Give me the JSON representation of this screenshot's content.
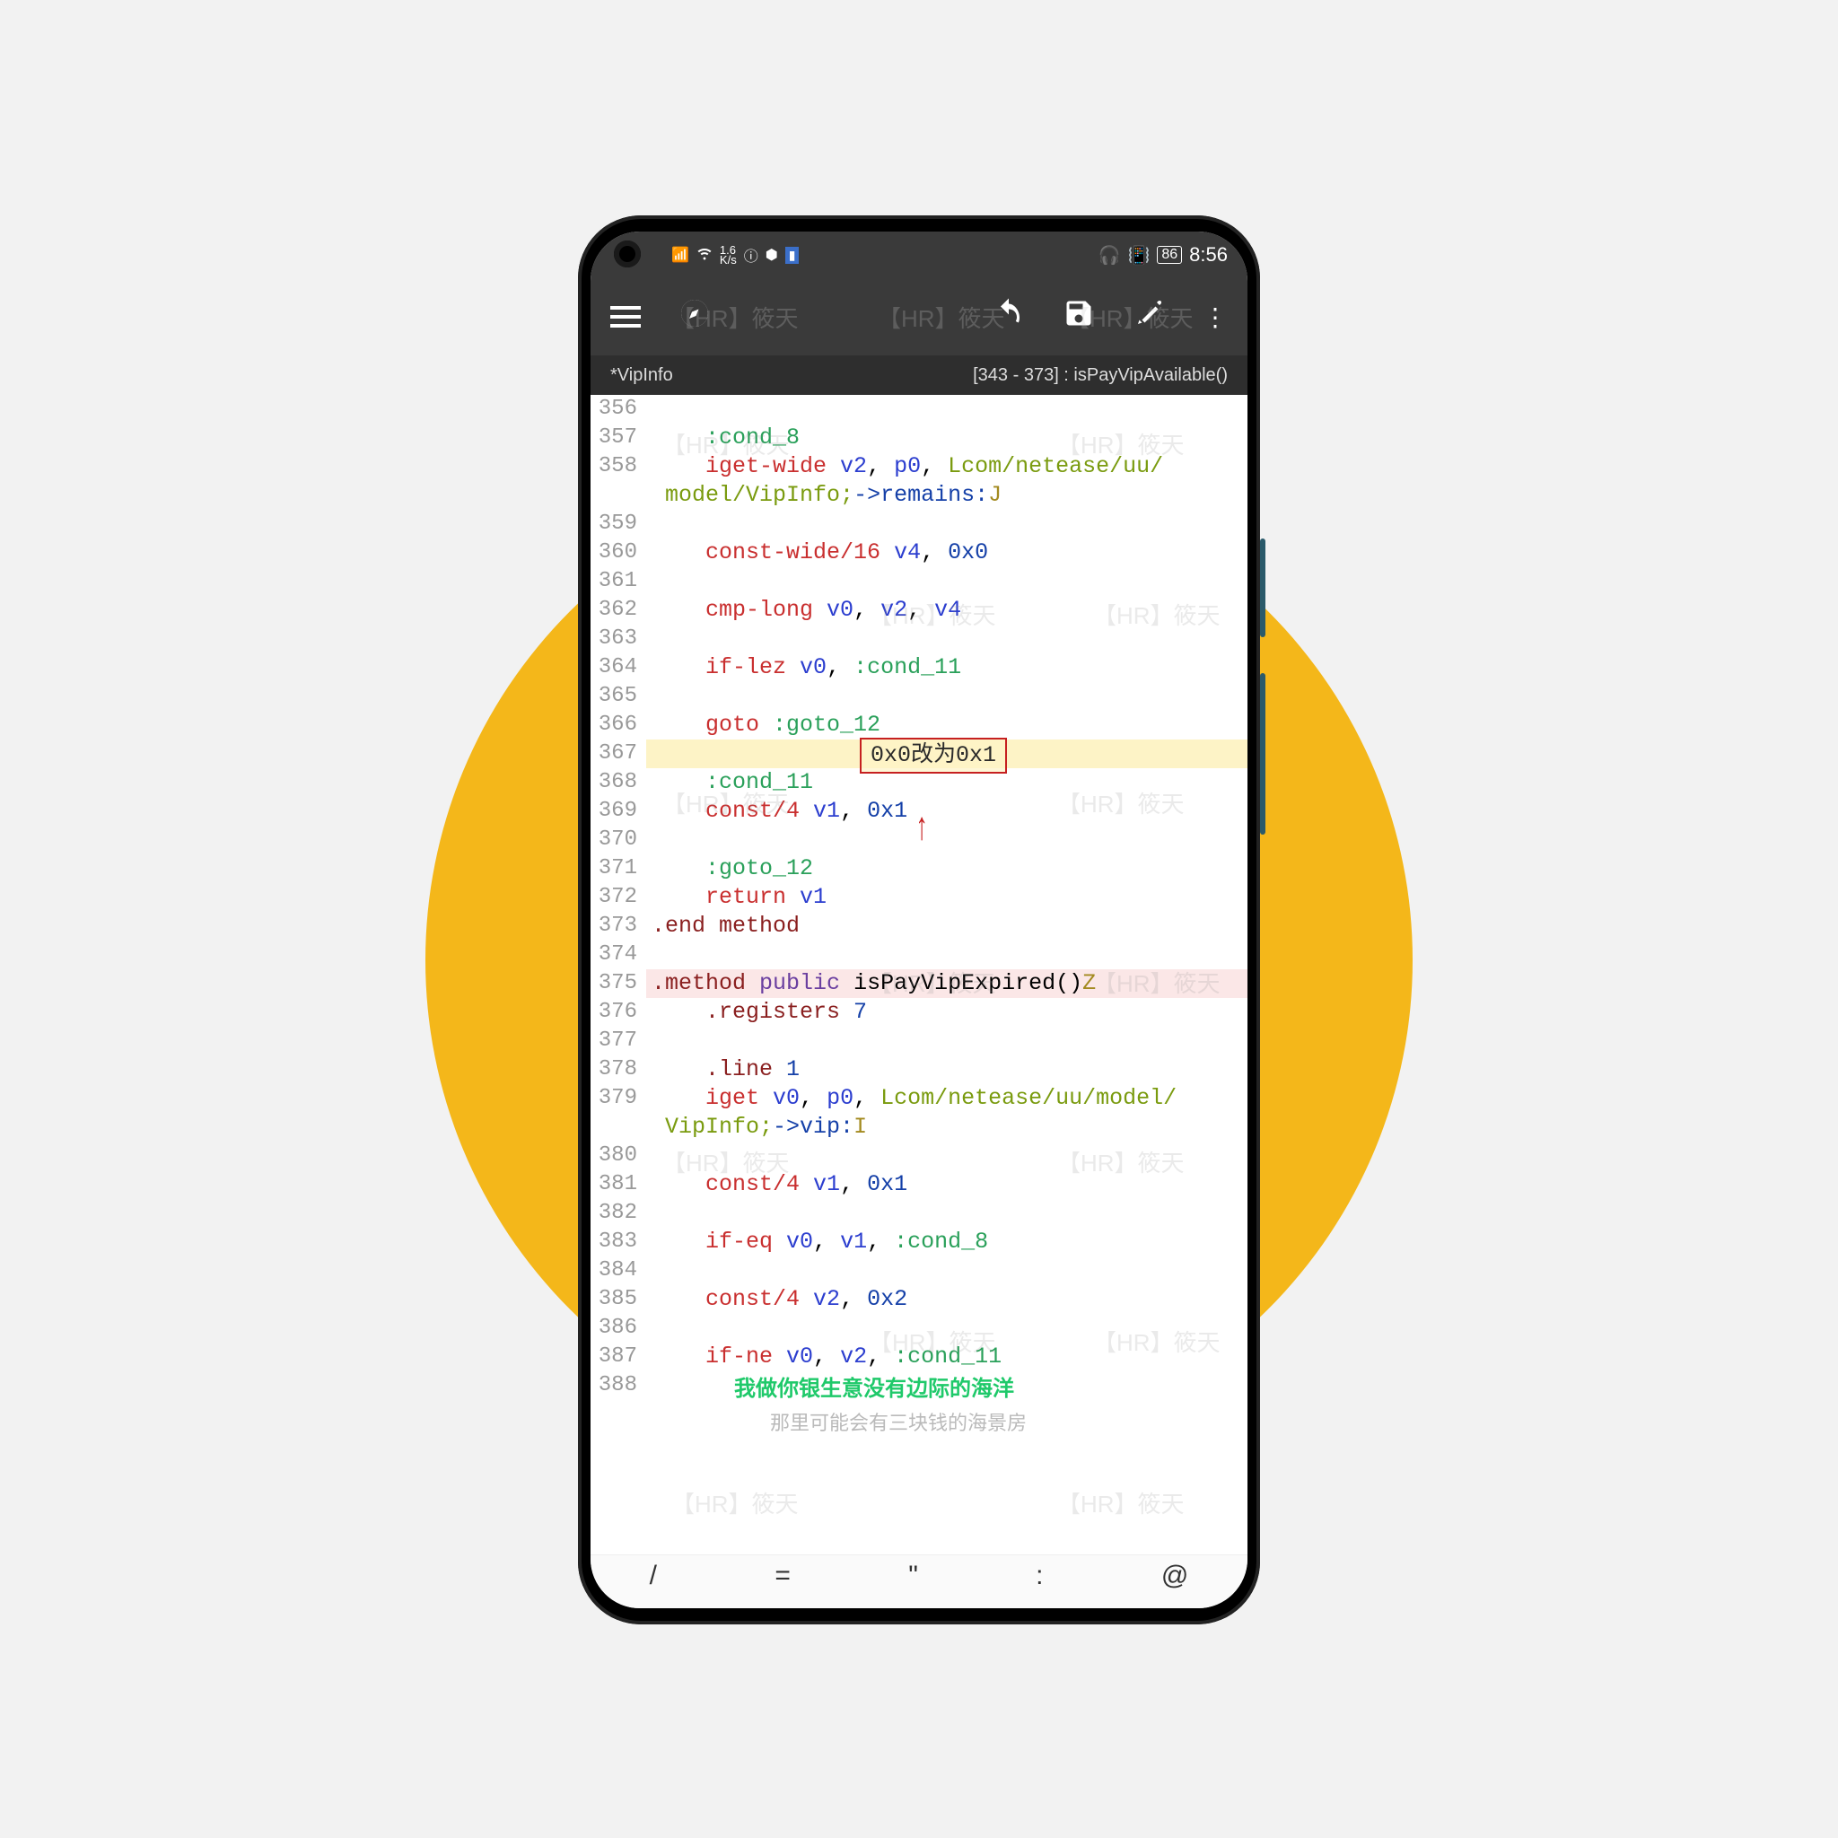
{
  "statusbar": {
    "speed": "1.6",
    "speed_unit": "K/s",
    "battery": "86",
    "time": "8:56"
  },
  "subbar": {
    "filename": "*VipInfo",
    "location": "[343 - 373] : isPayVipAvailable()"
  },
  "annotation": {
    "box": "0x0改为0x1"
  },
  "subtitles": {
    "line1": "我做你银生意没有边际的海洋",
    "line2": "那里可能会有三块钱的海景房"
  },
  "watermark": "【HR】筱天",
  "keyboard": [
    "/",
    "=",
    "\"",
    ":",
    "@"
  ],
  "code": [
    {
      "n": 356,
      "indent": 0,
      "seg": []
    },
    {
      "n": 357,
      "indent": 2,
      "seg": [
        [
          "k-teal",
          ":cond_8"
        ]
      ]
    },
    {
      "n": 358,
      "indent": 2,
      "seg": [
        [
          "k-red",
          "iget-wide "
        ],
        [
          "k-blue",
          "v2"
        ],
        [
          "",
          ", "
        ],
        [
          "k-blue",
          "p0"
        ],
        [
          "",
          ", "
        ],
        [
          "k-green",
          "Lcom/netease/uu/"
        ]
      ]
    },
    {
      "n": 0,
      "cont": true,
      "indent": 1,
      "seg": [
        [
          "k-green",
          "model/VipInfo;"
        ],
        [
          "k-darkblue",
          "->remains:"
        ],
        [
          "k-olive",
          "J"
        ]
      ]
    },
    {
      "n": 359,
      "indent": 0,
      "seg": []
    },
    {
      "n": 360,
      "indent": 2,
      "seg": [
        [
          "k-red",
          "const-wide/16 "
        ],
        [
          "k-blue",
          "v4"
        ],
        [
          "",
          ", "
        ],
        [
          "k-darkblue",
          "0x0"
        ]
      ]
    },
    {
      "n": 361,
      "indent": 0,
      "seg": []
    },
    {
      "n": 362,
      "indent": 2,
      "seg": [
        [
          "k-red",
          "cmp-long "
        ],
        [
          "k-blue",
          "v0"
        ],
        [
          "",
          ", "
        ],
        [
          "k-blue",
          "v2"
        ],
        [
          "",
          ", "
        ],
        [
          "k-blue",
          "v4"
        ]
      ]
    },
    {
      "n": 363,
      "indent": 0,
      "seg": []
    },
    {
      "n": 364,
      "indent": 2,
      "seg": [
        [
          "k-red",
          "if-lez "
        ],
        [
          "k-blue",
          "v0"
        ],
        [
          "",
          ", "
        ],
        [
          "k-teal",
          ":cond_11"
        ]
      ]
    },
    {
      "n": 365,
      "indent": 0,
      "seg": []
    },
    {
      "n": 366,
      "indent": 2,
      "seg": [
        [
          "k-red",
          "goto "
        ],
        [
          "k-teal",
          ":goto_12"
        ]
      ]
    },
    {
      "n": 367,
      "indent": 0,
      "seg": [],
      "hl": "hl-yellow"
    },
    {
      "n": 368,
      "indent": 2,
      "seg": [
        [
          "k-teal",
          ":cond_11"
        ]
      ]
    },
    {
      "n": 369,
      "indent": 2,
      "seg": [
        [
          "k-red",
          "const/4 "
        ],
        [
          "k-blue",
          "v1"
        ],
        [
          "",
          ", "
        ],
        [
          "k-darkblue",
          "0x1"
        ]
      ]
    },
    {
      "n": 370,
      "indent": 0,
      "seg": []
    },
    {
      "n": 371,
      "indent": 2,
      "seg": [
        [
          "k-teal",
          ":goto_12"
        ]
      ]
    },
    {
      "n": 372,
      "indent": 2,
      "seg": [
        [
          "k-red",
          "return "
        ],
        [
          "k-blue",
          "v1"
        ]
      ]
    },
    {
      "n": 373,
      "indent": 0,
      "seg": [
        [
          "k-darkred",
          ".end method"
        ]
      ]
    },
    {
      "n": 374,
      "indent": 0,
      "seg": []
    },
    {
      "n": 375,
      "indent": 0,
      "seg": [
        [
          "k-darkred",
          ".method "
        ],
        [
          "k-purple",
          "public "
        ],
        [
          "",
          "isPayVipExpired()"
        ],
        [
          "k-olive",
          "Z"
        ]
      ],
      "hl": "hl-pink"
    },
    {
      "n": 376,
      "indent": 2,
      "seg": [
        [
          "k-darkred",
          ".registers "
        ],
        [
          "k-darkblue",
          "7"
        ]
      ]
    },
    {
      "n": 377,
      "indent": 0,
      "seg": []
    },
    {
      "n": 378,
      "indent": 2,
      "seg": [
        [
          "k-darkred",
          ".line "
        ],
        [
          "k-darkblue",
          "1"
        ]
      ]
    },
    {
      "n": 379,
      "indent": 2,
      "seg": [
        [
          "k-red",
          "iget "
        ],
        [
          "k-blue",
          "v0"
        ],
        [
          "",
          ", "
        ],
        [
          "k-blue",
          "p0"
        ],
        [
          "",
          ", "
        ],
        [
          "k-green",
          "Lcom/netease/uu/model/"
        ]
      ]
    },
    {
      "n": 0,
      "cont": true,
      "indent": 1,
      "seg": [
        [
          "k-green",
          "VipInfo;"
        ],
        [
          "k-darkblue",
          "->vip:"
        ],
        [
          "k-olive",
          "I"
        ]
      ]
    },
    {
      "n": 380,
      "indent": 0,
      "seg": []
    },
    {
      "n": 381,
      "indent": 2,
      "seg": [
        [
          "k-red",
          "const/4 "
        ],
        [
          "k-blue",
          "v1"
        ],
        [
          "",
          ", "
        ],
        [
          "k-darkblue",
          "0x1"
        ]
      ]
    },
    {
      "n": 382,
      "indent": 0,
      "seg": []
    },
    {
      "n": 383,
      "indent": 2,
      "seg": [
        [
          "k-red",
          "if-eq "
        ],
        [
          "k-blue",
          "v0"
        ],
        [
          "",
          ", "
        ],
        [
          "k-blue",
          "v1"
        ],
        [
          "",
          ", "
        ],
        [
          "k-teal",
          ":cond_8"
        ]
      ]
    },
    {
      "n": 384,
      "indent": 0,
      "seg": []
    },
    {
      "n": 385,
      "indent": 2,
      "seg": [
        [
          "k-red",
          "const/4 "
        ],
        [
          "k-blue",
          "v2"
        ],
        [
          "",
          ", "
        ],
        [
          "k-darkblue",
          "0x2"
        ]
      ]
    },
    {
      "n": 386,
      "indent": 0,
      "seg": []
    },
    {
      "n": 387,
      "indent": 2,
      "seg": [
        [
          "k-red",
          "if-ne "
        ],
        [
          "k-blue",
          "v0"
        ],
        [
          "",
          ", "
        ],
        [
          "k-blue",
          "v2"
        ],
        [
          "",
          ", "
        ],
        [
          "k-teal",
          ":cond_11"
        ]
      ]
    },
    {
      "n": 388,
      "indent": 0,
      "seg": []
    }
  ]
}
